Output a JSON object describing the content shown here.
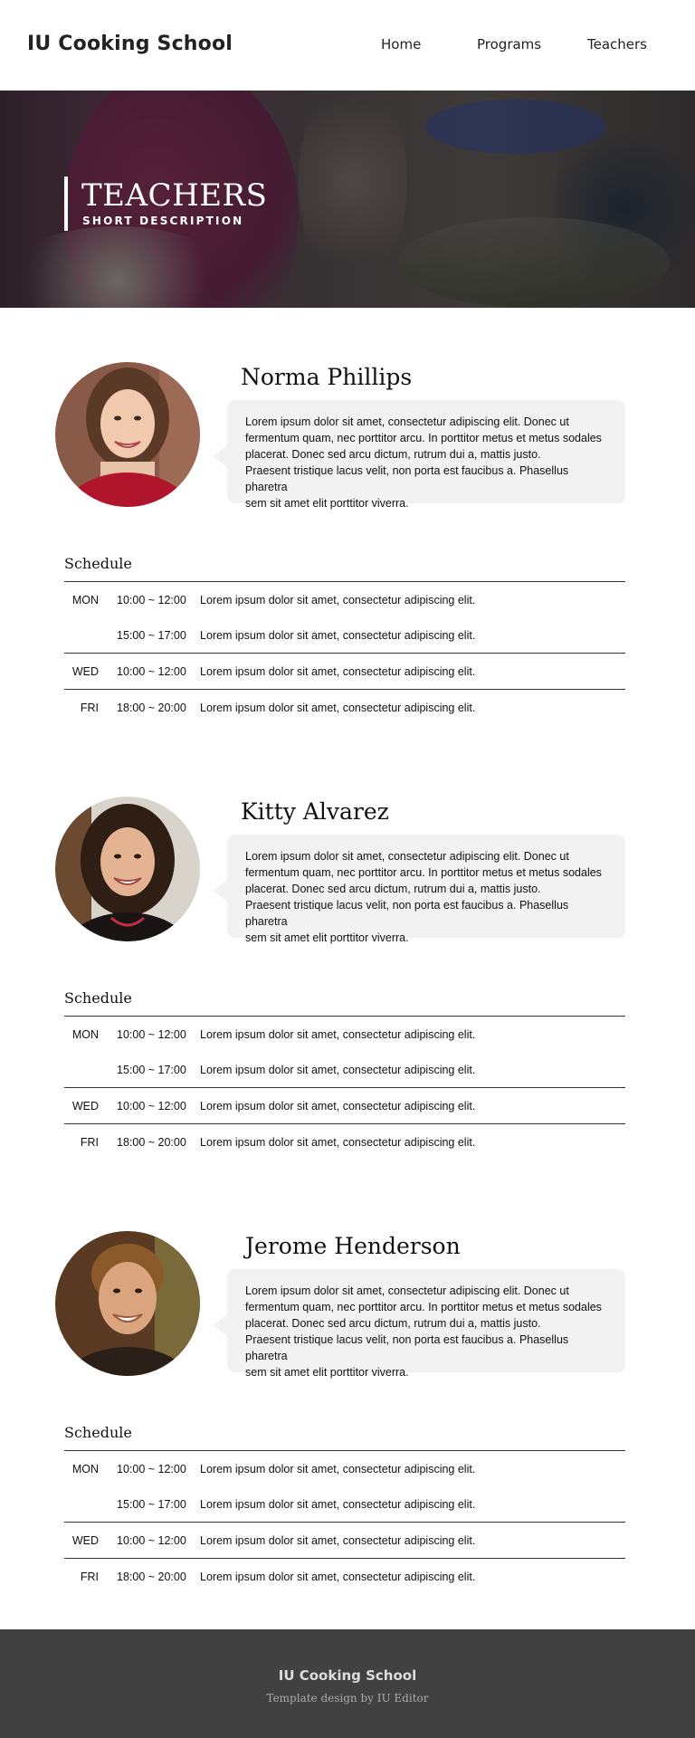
{
  "header": {
    "logo": "IU Cooking School",
    "nav": [
      {
        "label": "Home"
      },
      {
        "label": "Programs"
      },
      {
        "label": "Teachers"
      }
    ]
  },
  "hero": {
    "title": "TEACHERS",
    "subtitle": "SHORT DESCRIPTION"
  },
  "teachers": [
    {
      "name": "Norma Phillips",
      "bio_lines": [
        "Lorem ipsum dolor sit amet, consectetur adipiscing elit. Donec ut",
        "fermentum quam, nec porttitor arcu. In porttitor metus et metus sodales",
        "placerat. Donec sed arcu dictum, rutrum dui a, mattis justo.",
        "Praesent tristique lacus velit, non porta est faucibus a. Phasellus pharetra",
        "sem sit amet elit porttitor viverra."
      ],
      "schedule_title": "Schedule",
      "schedule": [
        {
          "day": "MON",
          "time": "10:00 ~ 12:00",
          "desc": "Lorem ipsum dolor sit amet, consectetur adipiscing elit."
        },
        {
          "day": "",
          "time": "15:00 ~ 17:00",
          "desc": "Lorem ipsum dolor sit amet, consectetur adipiscing elit."
        },
        {
          "day": "WED",
          "time": "10:00 ~ 12:00",
          "desc": "Lorem ipsum dolor sit amet, consectetur adipiscing elit."
        },
        {
          "day": "FRI",
          "time": "18:00 ~ 20:00",
          "desc": "Lorem ipsum dolor sit amet, consectetur adipiscing elit."
        }
      ]
    },
    {
      "name": "Kitty Alvarez",
      "bio_lines": [
        "Lorem ipsum dolor sit amet, consectetur adipiscing elit. Donec ut",
        "fermentum quam, nec porttitor arcu. In porttitor metus et metus sodales",
        "placerat. Donec sed arcu dictum, rutrum dui a, mattis justo.",
        "Praesent tristique lacus velit, non porta est faucibus a. Phasellus pharetra",
        "sem sit amet elit porttitor viverra."
      ],
      "schedule_title": "Schedule",
      "schedule": [
        {
          "day": "MON",
          "time": "10:00 ~ 12:00",
          "desc": "Lorem ipsum dolor sit amet, consectetur adipiscing elit."
        },
        {
          "day": "",
          "time": "15:00 ~ 17:00",
          "desc": "Lorem ipsum dolor sit amet, consectetur adipiscing elit."
        },
        {
          "day": "WED",
          "time": "10:00 ~ 12:00",
          "desc": "Lorem ipsum dolor sit amet, consectetur adipiscing elit."
        },
        {
          "day": "FRI",
          "time": "18:00 ~ 20:00",
          "desc": "Lorem ipsum dolor sit amet, consectetur adipiscing elit."
        }
      ]
    },
    {
      "name": "Jerome Henderson",
      "bio_lines": [
        "Lorem ipsum dolor sit amet, consectetur adipiscing elit. Donec ut",
        "fermentum quam, nec porttitor arcu. In porttitor metus et metus sodales",
        "placerat. Donec sed arcu dictum, rutrum dui a, mattis justo.",
        "Praesent tristique lacus velit, non porta est faucibus a. Phasellus pharetra",
        "sem sit amet elit porttitor viverra."
      ],
      "schedule_title": "Schedule",
      "schedule": [
        {
          "day": "MON",
          "time": "10:00 ~ 12:00",
          "desc": "Lorem ipsum dolor sit amet, consectetur adipiscing elit."
        },
        {
          "day": "",
          "time": "15:00 ~ 17:00",
          "desc": "Lorem ipsum dolor sit amet, consectetur adipiscing elit."
        },
        {
          "day": "WED",
          "time": "10:00 ~ 12:00",
          "desc": "Lorem ipsum dolor sit amet, consectetur adipiscing elit."
        },
        {
          "day": "FRI",
          "time": "18:00 ~ 20:00",
          "desc": "Lorem ipsum dolor sit amet, consectetur adipiscing elit."
        }
      ]
    }
  ],
  "footer": {
    "title": "IU Cooking School",
    "credit": "Template design by IU Editor"
  }
}
